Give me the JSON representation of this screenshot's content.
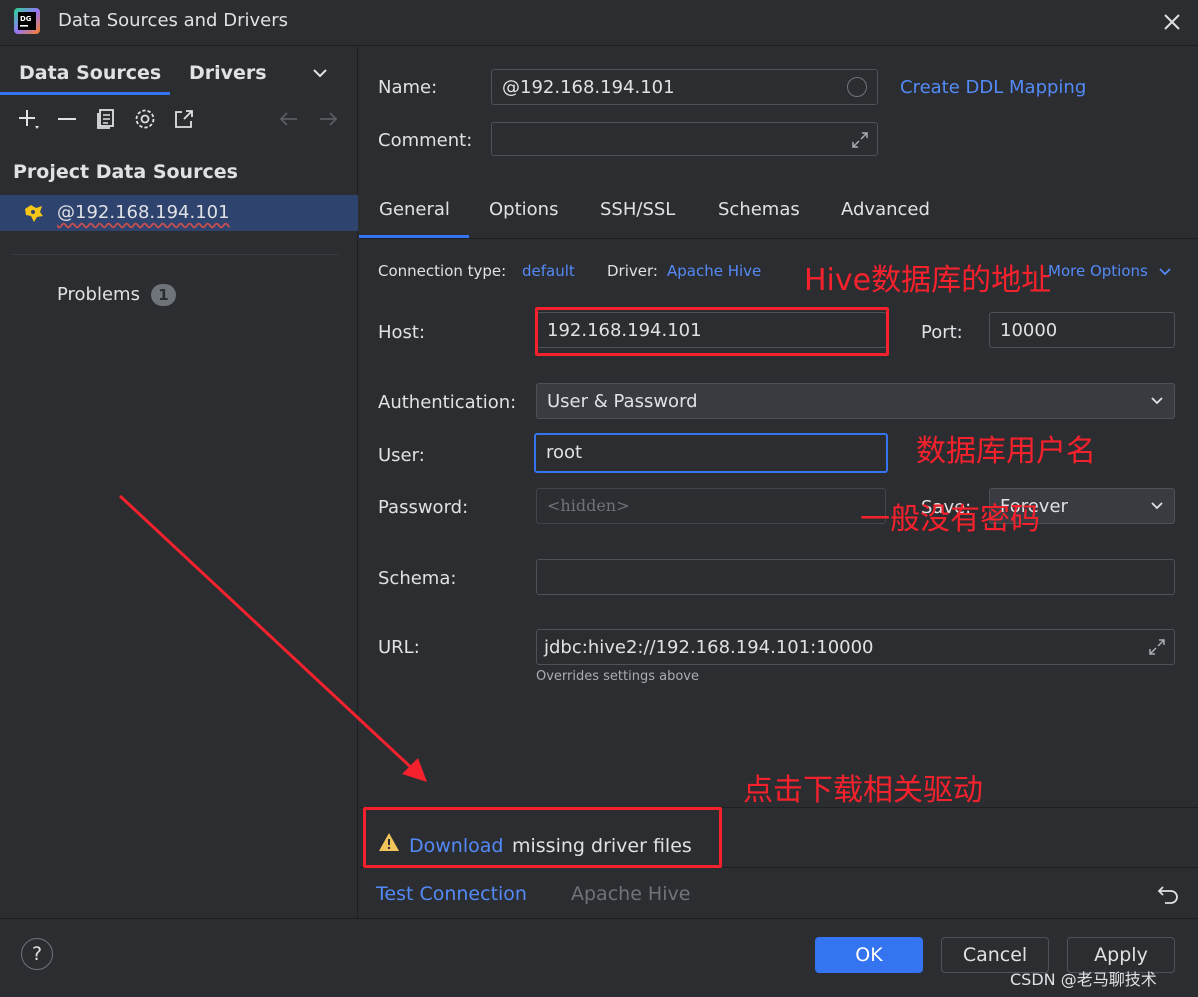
{
  "window": {
    "title": "Data Sources and Drivers"
  },
  "left": {
    "tabs": [
      "Data Sources",
      "Drivers"
    ],
    "section_title": "Project Data Sources",
    "datasource": "@192.168.194.101",
    "problems_label": "Problems",
    "problems_count": "1"
  },
  "form": {
    "name_label": "Name:",
    "name_value": "@192.168.194.101",
    "create_ddl": "Create DDL Mapping",
    "comment_label": "Comment:",
    "comment_value": "",
    "tabs": [
      "General",
      "Options",
      "SSH/SSL",
      "Schemas",
      "Advanced"
    ],
    "conn_type_label": "Connection type:",
    "conn_type_value": "default",
    "driver_label": "Driver:",
    "driver_value": "Apache Hive",
    "more_options": "More Options",
    "host_label": "Host:",
    "host_value": "192.168.194.101",
    "port_label": "Port:",
    "port_value": "10000",
    "auth_label": "Authentication:",
    "auth_value": "User & Password",
    "user_label": "User:",
    "user_value": "root",
    "password_label": "Password:",
    "password_placeholder": "<hidden>",
    "save_label": "Save:",
    "save_value": "Forever",
    "schema_label": "Schema:",
    "schema_value": "",
    "url_label": "URL:",
    "url_value": "jdbc:hive2://192.168.194.101:10000",
    "url_hint": "Overrides settings above",
    "download_link": "Download",
    "download_rest": "missing driver files",
    "test_connection": "Test Connection",
    "driver_footer": "Apache Hive"
  },
  "footer": {
    "help": "?",
    "ok": "OK",
    "cancel": "Cancel",
    "apply": "Apply",
    "watermark": "CSDN @老马聊技术"
  },
  "annotations": {
    "host_note": "Hive数据库的地址",
    "user_note": "数据库用户名",
    "password_note": "一般没有密码",
    "download_note": "点击下载相关驱动"
  },
  "colors": {
    "accent": "#3574f0",
    "link": "#548af7",
    "annotation_red": "#f5222d",
    "background": "#2b2d30",
    "warning_yellow": "#f2c55c"
  }
}
